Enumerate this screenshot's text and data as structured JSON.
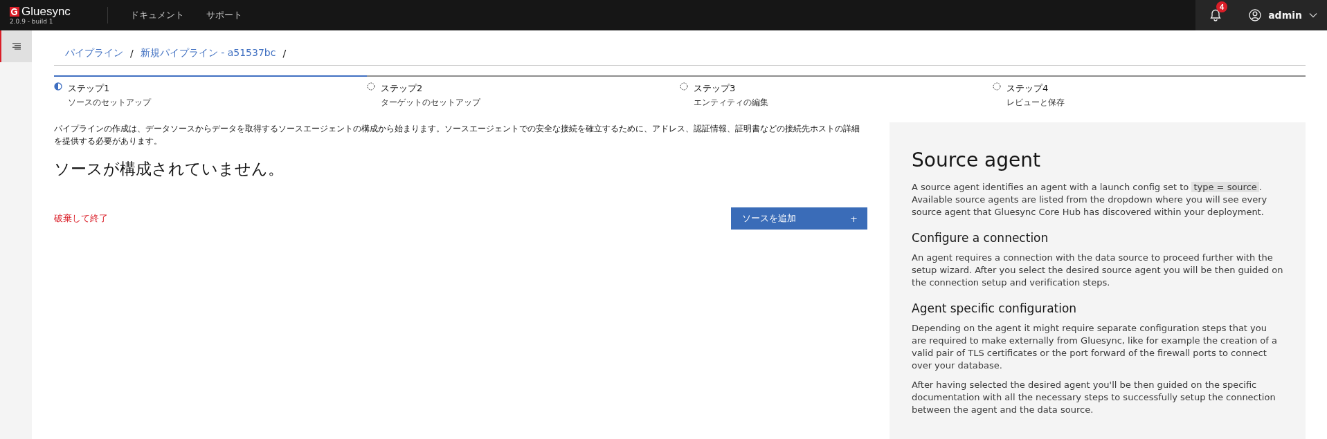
{
  "header": {
    "brand": "Gluesync",
    "version": "2.0.9 - build 1",
    "nav": [
      "ドキュメント",
      "サポート"
    ],
    "notifications": "4",
    "user": "admin"
  },
  "breadcrumb": {
    "items": [
      "パイプライン",
      "新規パイプライン - a51537bc"
    ],
    "separator": "/"
  },
  "steps": [
    {
      "title": "ステップ1",
      "subtitle": "ソースのセットアップ",
      "selected": true
    },
    {
      "title": "ステップ2",
      "subtitle": "ターゲットのセットアップ",
      "selected": false
    },
    {
      "title": "ステップ3",
      "subtitle": "エンティティの編集",
      "selected": false
    },
    {
      "title": "ステップ4",
      "subtitle": "レビューと保存",
      "selected": false
    }
  ],
  "intro": "パイプラインの作成は、データソースからデータを取得するソースエージェントの構成から始まります。ソースエージェントでの安全な接続を確立するために、アドレス、認証情報、証明書などの接続先ホストの詳細を提供する必要があります。",
  "empty_heading": "ソースが構成されていません。",
  "discard_link": "破棄して終了",
  "add_button": {
    "label": "ソースを追加",
    "icon": "+"
  },
  "help": {
    "title": "Source agent",
    "sections": [
      {
        "kind": "intro",
        "before": "A source agent identifies an agent with a launch config set to",
        "code": "type = source",
        "after": ". Available source agents are listed from the dropdown where you will see every source agent that Gluesync Core Hub has discovered within your deployment."
      },
      {
        "kind": "section",
        "heading": "Configure a connection",
        "paragraphs": [
          "An agent requires a connection with the data source to proceed further with the setup wizard. After you select the desired source agent you will be then guided on the connection setup and verification steps."
        ]
      },
      {
        "kind": "section",
        "heading": "Agent specific configuration",
        "paragraphs": [
          "Depending on the agent it might require separate configuration steps that you are required to make externally from Gluesync, like for example the creation of a valid pair of TLS certificates or the port forward of the firewall ports to connect over your database.",
          "After having selected the desired agent you'll be then guided on the specific documentation with all the necessary steps to successfully setup the connection between the agent and the data source."
        ]
      }
    ]
  }
}
